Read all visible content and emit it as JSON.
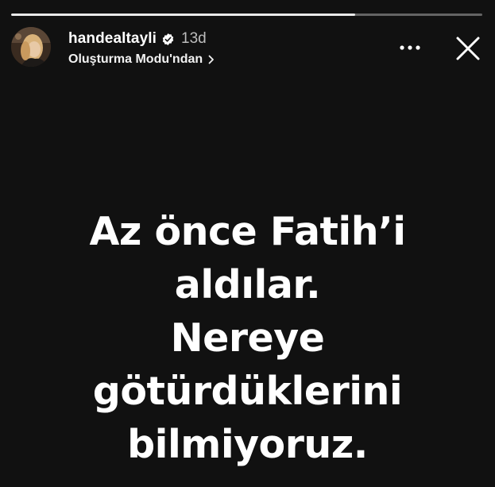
{
  "story": {
    "progress": 0.73,
    "user": {
      "username": "handealtayli",
      "verified": true,
      "time_ago": "13d",
      "subtitle": "Oluşturma Modu'ndan"
    },
    "text_lines": [
      "Az önce Fatih’i",
      "aldılar.",
      "Nereye",
      "götürdüklerini",
      "bilmiyoruz."
    ]
  },
  "icons": {
    "verified": "verified-badge-icon",
    "subtitle_chevron": "chevron-right-icon",
    "more": "more-horizontal-icon",
    "close": "close-icon"
  },
  "colors": {
    "background": "#111111",
    "text": "#ffffff",
    "secondary_text": "#bdbdbd",
    "verified_badge": "#ffffff"
  }
}
